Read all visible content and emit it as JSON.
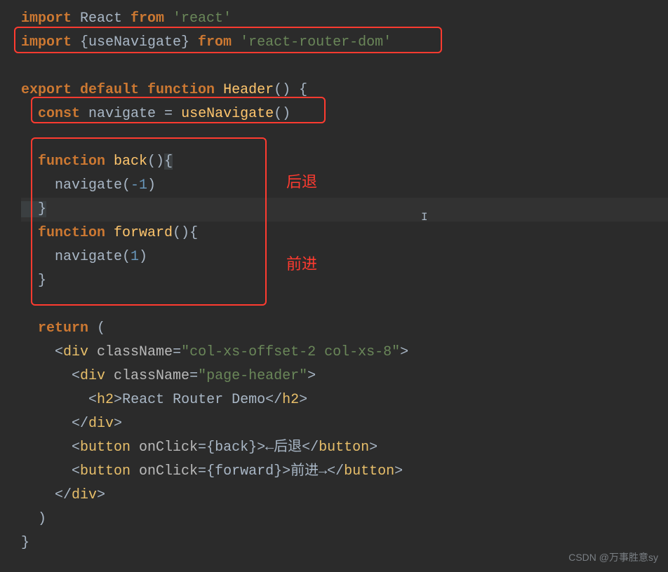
{
  "code": {
    "l1_import": "import",
    "l1_react": " React ",
    "l1_from": "from",
    "l1_str": " 'react'",
    "l2_import": "import",
    "l2_un": " {useNavigate} ",
    "l2_from": "from",
    "l2_str": " 'react-router-dom'",
    "l4_export": "export",
    "l4_default": " default ",
    "l4_function": "function",
    "l4_header": " Header",
    "l4_paren": "()",
    "l4_brace": " {",
    "l5_const": "  const",
    "l5_nav": " navigate ",
    "l5_eq": "=",
    "l5_usen": " useNavigate",
    "l5_call": "()",
    "l7_fn": "  function",
    "l7_back": " back",
    "l7_paren": "()",
    "l7_brace": "{",
    "l8_nav": "    navigate(",
    "l8_num": "-1",
    "l8_close": ")",
    "l9_brace": "  }",
    "l10_fn": "  function",
    "l10_fw": " forward",
    "l10_paren": "()",
    "l10_brace": "{",
    "l11_nav": "    navigate(",
    "l11_num": "1",
    "l11_close": ")",
    "l12_brace": "  }",
    "l14_return": "  return",
    "l14_paren": " (",
    "l15_open": "    <",
    "l15_div": "div",
    "l15_cn": " className",
    "l15_eq": "=",
    "l15_str": "\"col-xs-offset-2 col-xs-8\"",
    "l15_close": ">",
    "l16_open": "      <",
    "l16_div": "div",
    "l16_cn": " className",
    "l16_eq": "=",
    "l16_str": "\"page-header\"",
    "l16_close": ">",
    "l17_open": "        <",
    "l17_h2": "h2",
    "l17_close1": ">",
    "l17_text": "React Router Demo",
    "l17_open2": "</",
    "l17_h2b": "h2",
    "l17_close2": ">",
    "l18_close": "      </",
    "l18_div": "div",
    "l18_close2": ">",
    "l19_open": "      <",
    "l19_btn": "button",
    "l19_oc": " onClick",
    "l19_eq": "=",
    "l19_br1": "{",
    "l19_back": "back",
    "l19_br2": "}",
    "l19_close": ">",
    "l19_text": "←后退",
    "l19_open2": "</",
    "l19_btn2": "button",
    "l19_close2": ">",
    "l20_open": "      <",
    "l20_btn": "button",
    "l20_oc": " onClick",
    "l20_eq": "=",
    "l20_br1": "{",
    "l20_fw": "forward",
    "l20_br2": "}",
    "l20_close": ">",
    "l20_text": "前进→",
    "l20_open2": "</",
    "l20_btn2": "button",
    "l20_close2": ">",
    "l21_close": "    </",
    "l21_div": "div",
    "l21_close2": ">",
    "l22_paren": "  )",
    "l23_brace": "}"
  },
  "annotations": {
    "back_label": "后退",
    "forward_label": "前进"
  },
  "watermark": "CSDN @万事胜意sy"
}
